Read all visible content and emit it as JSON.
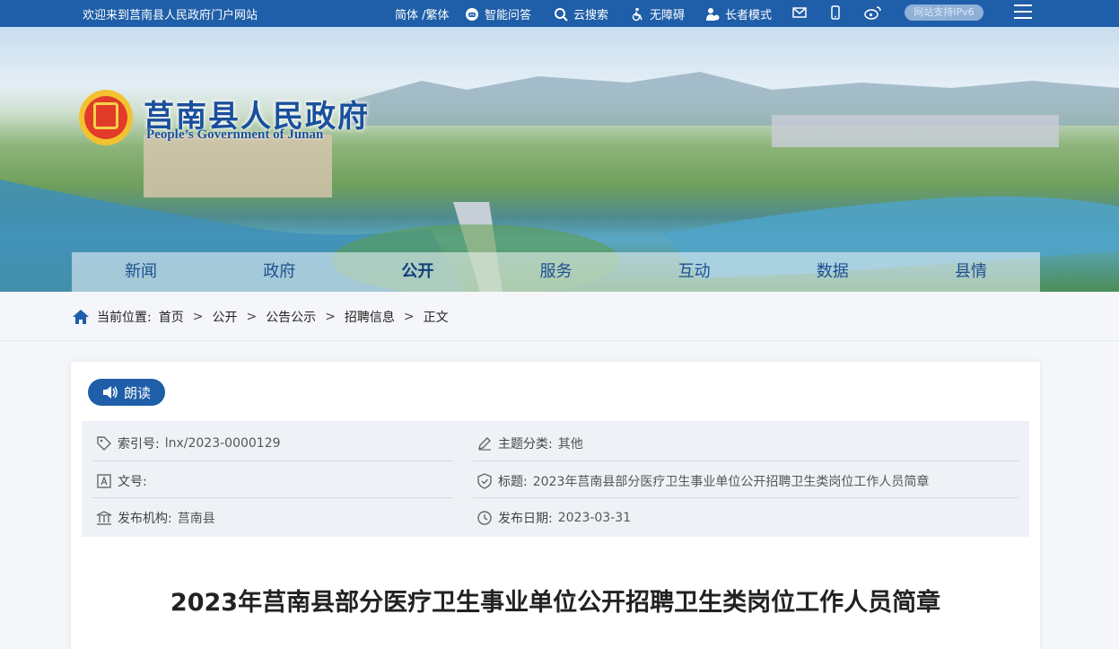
{
  "topbar": {
    "welcome": "欢迎来到莒南县人民政府门户网站",
    "lang": "简体 /繁体",
    "qa": "智能问答",
    "search": "云搜索",
    "accessible": "无障碍",
    "elder": "长者模式",
    "ipv6": "网站支持IPv6"
  },
  "header": {
    "title": "莒南县人民政府",
    "subtitle": "People’s Government of Junan"
  },
  "nav": [
    "新闻",
    "政府",
    "公开",
    "服务",
    "互动",
    "数据",
    "县情"
  ],
  "breadcrumb": {
    "prefix": "当前位置:",
    "items": [
      "首页",
      "公开",
      "公告公示",
      "招聘信息",
      "正文"
    ]
  },
  "read_label": "朗读",
  "meta": {
    "index_label": "索引号:",
    "index_value": "lnx/2023-0000129",
    "category_label": "主题分类:",
    "category_value": "其他",
    "docno_label": "文号:",
    "docno_value": "",
    "title_label": "标题:",
    "title_value": "2023年莒南县部分医疗卫生事业单位公开招聘卫生类岗位工作人员简章",
    "publisher_label": "发布机构:",
    "publisher_value": "莒南县",
    "date_label": "发布日期:",
    "date_value": "2023-03-31"
  },
  "doc_title": "2023年莒南县部分医疗卫生事业单位公开招聘卫生类岗位工作人员简章",
  "colors": {
    "primary": "#1f5ea8",
    "meta_bg": "#eef2f6"
  }
}
